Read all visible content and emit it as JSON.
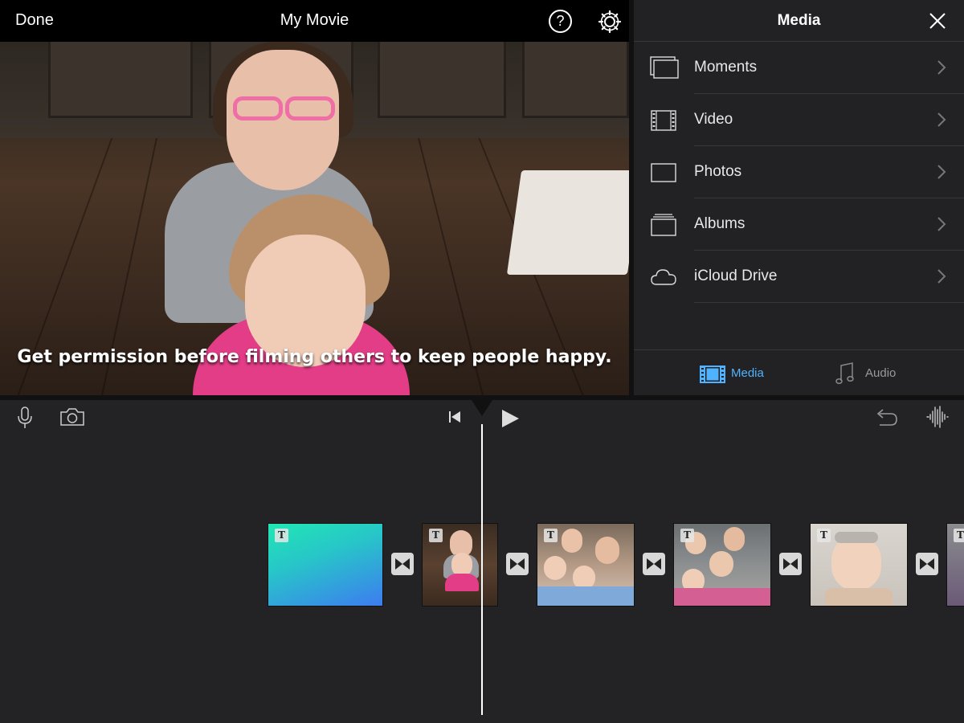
{
  "topbar": {
    "done_label": "Done",
    "title": "My Movie",
    "help_glyph": "?",
    "settings_icon": "gear-icon"
  },
  "viewer": {
    "subtitle": "Get permission before filming others to keep people happy."
  },
  "media_panel": {
    "title": "Media",
    "close_icon": "close-icon",
    "items": [
      {
        "label": "Moments",
        "icon": "moments-icon"
      },
      {
        "label": "Video",
        "icon": "film-icon"
      },
      {
        "label": "Photos",
        "icon": "photo-icon"
      },
      {
        "label": "Albums",
        "icon": "albums-icon"
      },
      {
        "label": "iCloud Drive",
        "icon": "cloud-icon"
      }
    ],
    "tabs": [
      {
        "label": "Media",
        "icon": "film-icon",
        "active": true
      },
      {
        "label": "Audio",
        "icon": "music-note-icon",
        "active": false
      }
    ]
  },
  "timeline": {
    "tools_left": [
      "microphone-icon",
      "camera-icon"
    ],
    "tools_center": [
      "skip-to-start-icon",
      "play-icon"
    ],
    "tools_right": [
      "undo-icon",
      "audio-waveform-icon"
    ],
    "clip_title_badge": "T",
    "clips": [
      {
        "type": "title-gradient"
      },
      {
        "type": "photo"
      },
      {
        "type": "photo"
      },
      {
        "type": "photo"
      },
      {
        "type": "photo"
      },
      {
        "type": "photo"
      }
    ]
  },
  "colors": {
    "accent_blue": "#4fb3ff",
    "background": "#232325",
    "subtitle_pink": "#e23d86"
  }
}
